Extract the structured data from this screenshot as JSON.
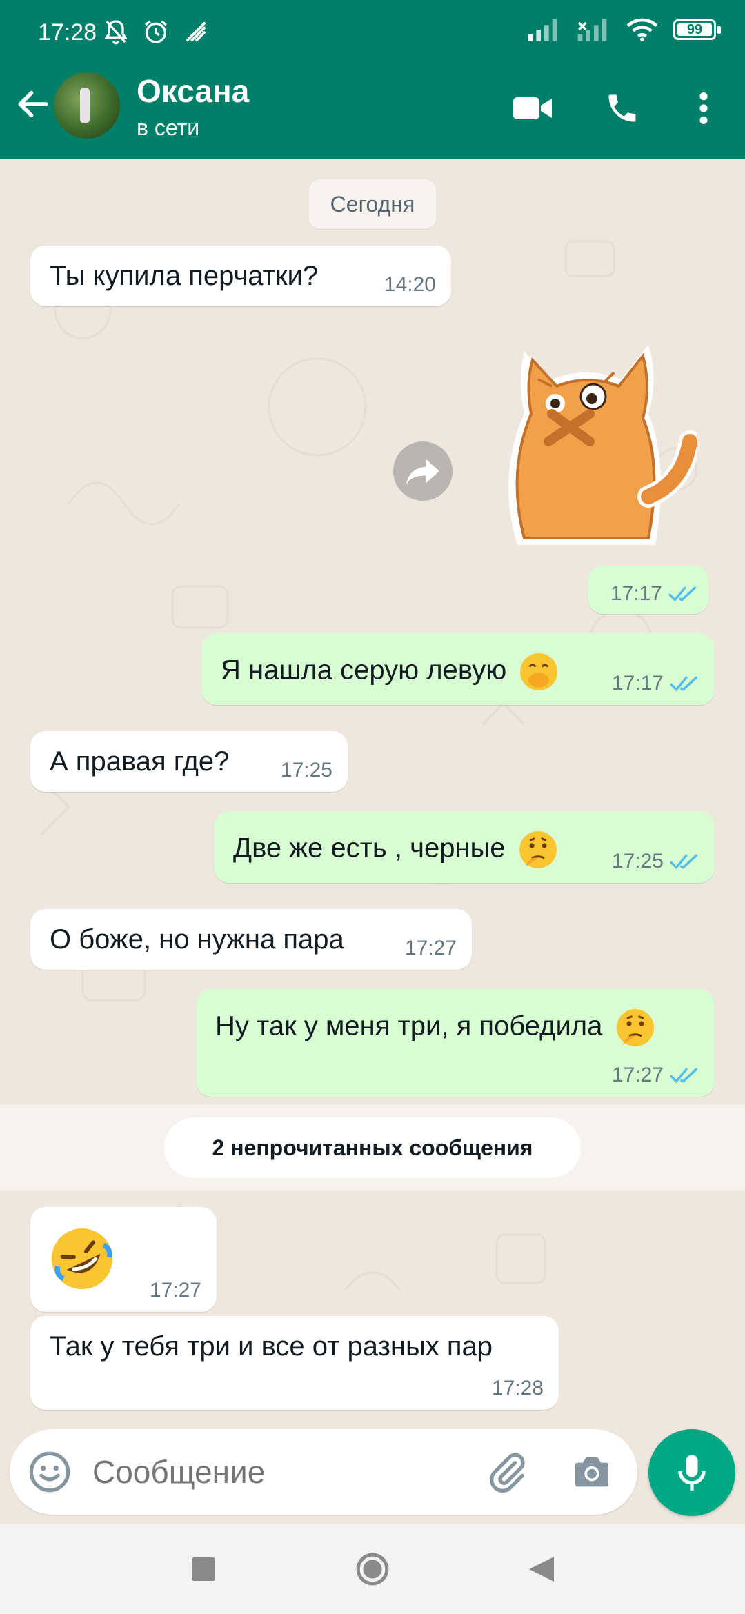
{
  "status_bar": {
    "time": "17:28",
    "battery": "99",
    "icons_left": [
      "mute-bell-icon",
      "alarm-icon",
      "app-notification-icon"
    ],
    "icons_right": [
      "signal-icon",
      "signal-off-icon",
      "wifi-icon",
      "battery-icon"
    ]
  },
  "header": {
    "contact_name": "Оксана",
    "contact_status": "в сети",
    "icons": [
      "back-arrow-icon",
      "video-call-icon",
      "phone-icon",
      "more-vert-icon"
    ]
  },
  "chat": {
    "date_label": "Сегодня",
    "messages": [
      {
        "dir": "in",
        "text": "Ты купила перчатки?",
        "time": "14:20"
      },
      {
        "dir": "out",
        "type": "sticker",
        "sticker": "orange-cat-sticker",
        "time": "17:17",
        "read": true
      },
      {
        "dir": "out",
        "text": "Я нашла серую левую",
        "emoji": "face-with-hand-over-mouth",
        "time": "17:17",
        "read": true
      },
      {
        "dir": "in",
        "text": "А правая где?",
        "time": "17:25"
      },
      {
        "dir": "out",
        "text": "Две же есть , черные",
        "emoji": "thinking-face",
        "time": "17:25",
        "read": true
      },
      {
        "dir": "in",
        "text": "О боже, но нужна пара",
        "time": "17:27"
      },
      {
        "dir": "out",
        "text": "Ну так у меня три, я победила",
        "emoji": "thinking-face",
        "time": "17:27",
        "read": true
      },
      {
        "dir": "in",
        "type": "emoji",
        "emoji": "rolling-on-floor-laughing",
        "time": "17:27"
      },
      {
        "dir": "in",
        "text": "Так у тебя три и все от разных пар",
        "time": "17:28"
      }
    ],
    "unread_label": "2 непрочитанных сообщения"
  },
  "composer": {
    "placeholder": "Сообщение",
    "icons": [
      "emoji-icon",
      "attach-icon",
      "camera-icon",
      "mic-icon"
    ]
  },
  "nav": {
    "icons": [
      "recents-square-icon",
      "home-circle-icon",
      "back-triangle-icon"
    ]
  },
  "colors": {
    "header": "#008069",
    "chat_bg": "#efe7de",
    "outgoing_bubble": "#d9fdd3",
    "incoming_bubble": "#ffffff",
    "ticks": "#53bdeb",
    "mic_button": "#00a884"
  }
}
